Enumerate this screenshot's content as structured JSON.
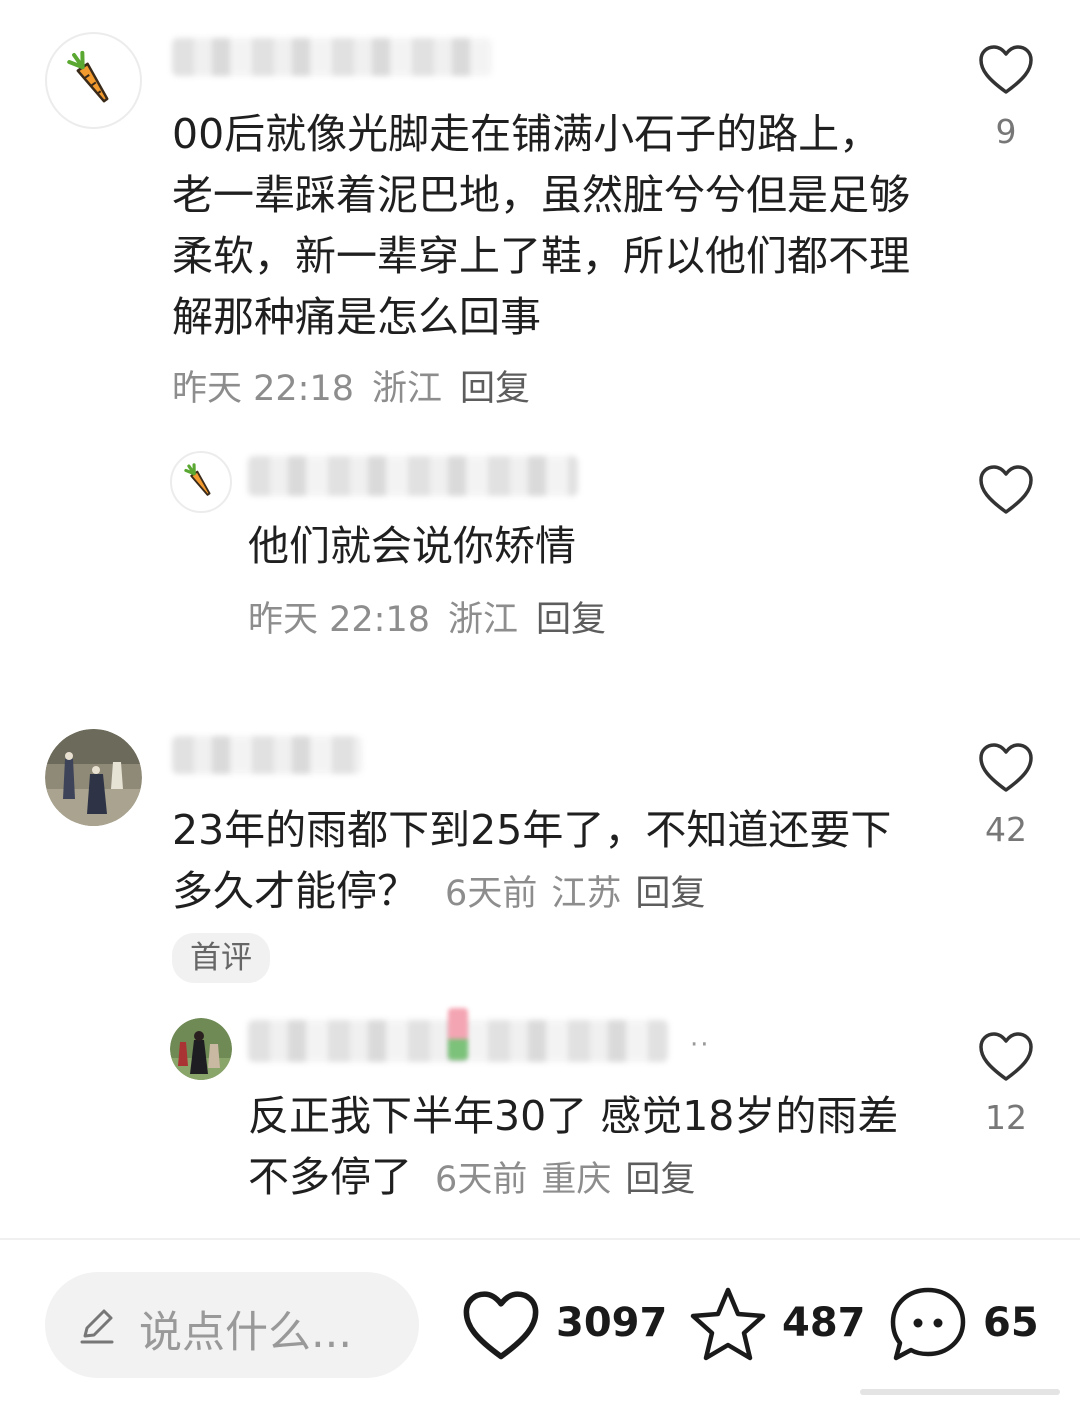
{
  "comments": [
    {
      "text": "00后就像光脚走在铺满小石子的路上，老一辈踩着泥巴地，虽然脏兮兮但是足够柔软，新一辈穿上了鞋，所以他们都不理解那种痛是怎么回事",
      "time": "昨天 22:18",
      "location": "浙江",
      "reply_label": "回复",
      "likes": "9",
      "reply": {
        "text": "他们就会说你矫情",
        "time": "昨天 22:18",
        "location": "浙江",
        "reply_label": "回复"
      }
    },
    {
      "text": "23年的雨都下到25年了，不知道还要下多久才能停？",
      "time": "6天前",
      "location": "江苏",
      "reply_label": "回复",
      "likes": "42",
      "tag": "首评",
      "reply": {
        "text": "反正我下半年30了 感觉18岁的雨差不多停了",
        "time": "6天前",
        "location": "重庆",
        "reply_label": "回复",
        "likes": "12"
      }
    }
  ],
  "bottom_bar": {
    "input_placeholder": "说点什么...",
    "like_count": "3097",
    "star_count": "487",
    "comment_count": "65"
  },
  "icons": {
    "avatar_1": "carrot-icon",
    "avatar_2": "carrot-icon",
    "like": "heart-outline-icon",
    "edit": "pencil-icon",
    "star": "star-outline-icon",
    "comment": "chat-bubble-icon"
  }
}
